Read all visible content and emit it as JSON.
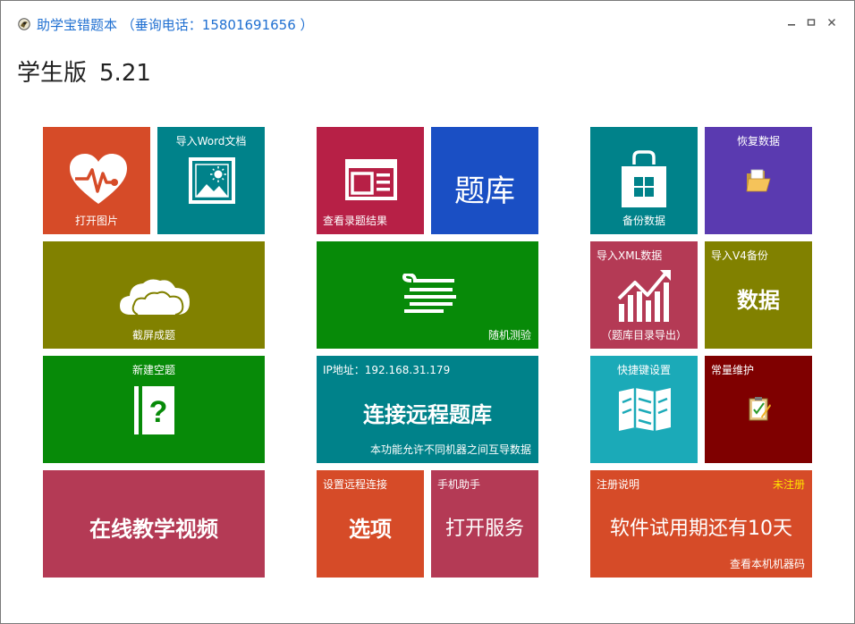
{
  "window": {
    "title": "助学宝错题本 （垂询电话：15801691656 ）",
    "icons": [
      "app-logo-icon",
      "minimize-icon",
      "maximize-icon",
      "close-icon"
    ]
  },
  "edition": {
    "name": "学生版",
    "version": "5.21"
  },
  "colors": {
    "orange": "#d64b28",
    "teal": "#00828a",
    "crimson": "#b72046",
    "blue": "#1a4fc4",
    "olive": "#818100",
    "green": "#078a08",
    "purple": "#5a3ab0",
    "rose": "#b43a55",
    "cyan": "#1baab8",
    "maroon": "#7f0000",
    "title_blue": "#1f6fd1",
    "unregistered_yellow": "#ffe100"
  },
  "tiles": {
    "open_image": {
      "label": "打开图片",
      "icon": "heart-pulse-icon"
    },
    "import_word": {
      "label": "导入Word文档",
      "icon": "picture-icon"
    },
    "view_results": {
      "label": "查看录题结果",
      "icon": "news-icon"
    },
    "question_bank": {
      "text": "题库"
    },
    "backup": {
      "label": "备份数据",
      "icon": "store-bag-icon"
    },
    "restore": {
      "label": "恢复数据",
      "icon": "folder-icon"
    },
    "screenshot": {
      "label": "截屏成题",
      "icon": "cloud-icon"
    },
    "random_test": {
      "label": "随机测验",
      "icon": "wind-lines-icon"
    },
    "import_xml": {
      "label": "导入XML数据",
      "sublabel": "（题库目录导出）",
      "icon": "chart-up-icon"
    },
    "import_v4": {
      "label": "导入V4备份",
      "text": "数据"
    },
    "new_blank": {
      "label": "新建空题",
      "icon": "question-book-icon"
    },
    "remote_bank": {
      "ip_label": "IP地址：192.168.31.179",
      "text": "连接远程题库",
      "note": "本功能允许不同机器之间互导数据"
    },
    "hotkeys": {
      "label": "快捷键设置",
      "icon": "map-icon"
    },
    "maintenance": {
      "label": "常量维护",
      "icon": "clipboard-icon"
    },
    "online_video": {
      "text": "在线教学视频"
    },
    "options": {
      "label": "设置远程连接",
      "text": "选项"
    },
    "phone_helper": {
      "label": "手机助手",
      "text": "打开服务"
    },
    "registration": {
      "label": "注册说明",
      "status": "未注册",
      "text": "软件试用期还有10天",
      "link": "查看本机机器码"
    }
  }
}
